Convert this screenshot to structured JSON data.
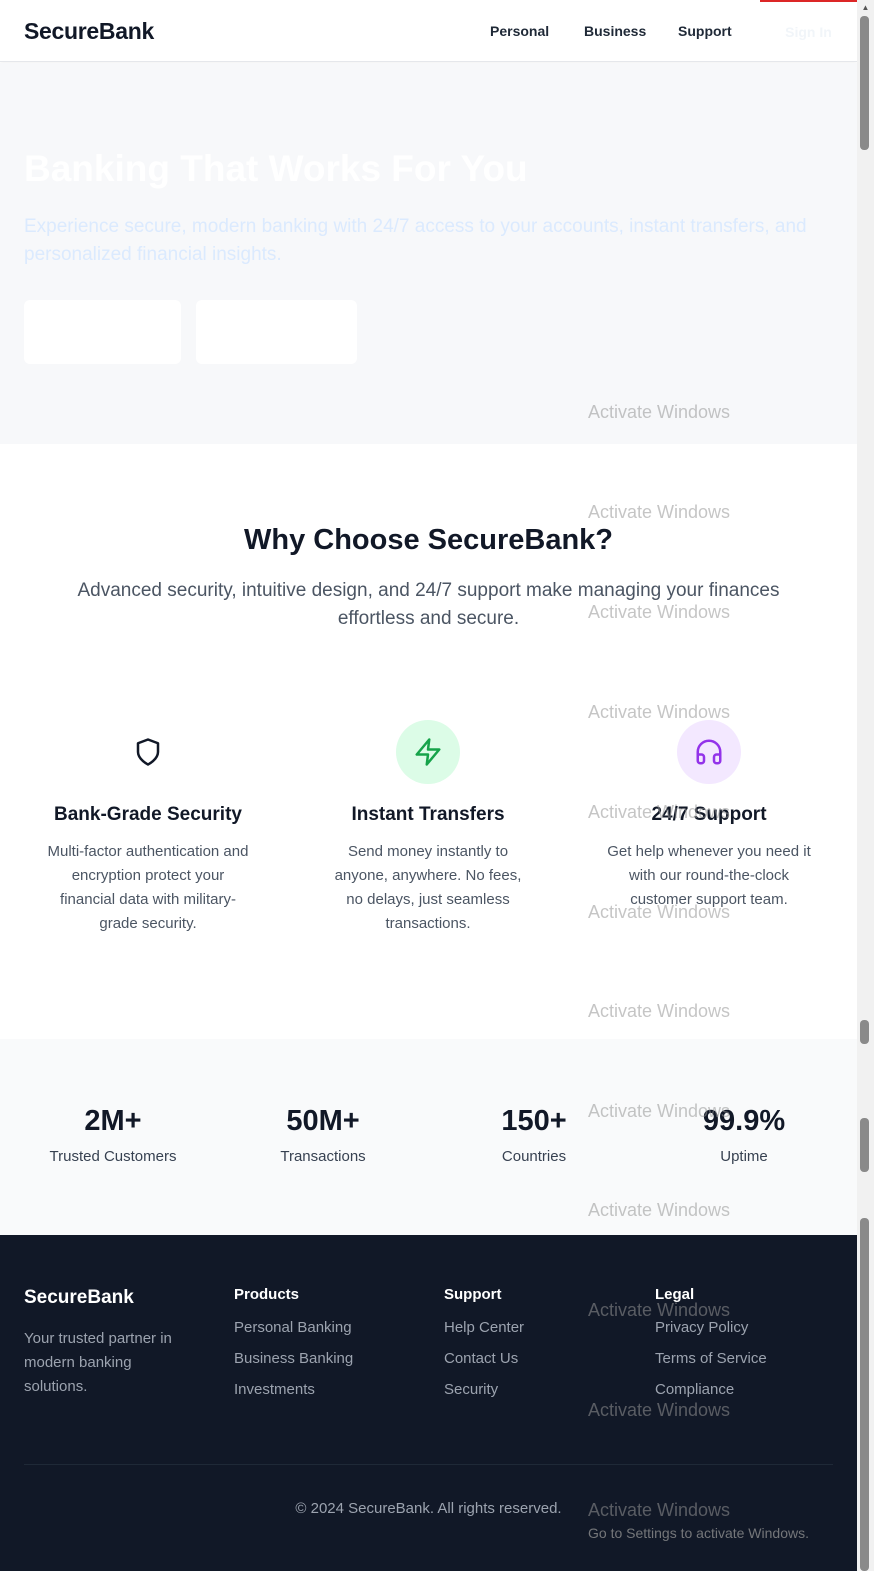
{
  "header": {
    "logo": "SecureBank",
    "nav": [
      "Personal",
      "Business",
      "Support"
    ],
    "signin": "Sign In"
  },
  "hero": {
    "title": "Banking That Works For You",
    "subtitle": "Experience secure, modern banking with 24/7 access to your accounts, instant transfers, and personalized financial insights."
  },
  "features": {
    "title": "Why Choose SecureBank?",
    "subtitle": "Advanced security, intuitive design, and 24/7 support make managing your finances effortless and secure.",
    "items": [
      {
        "icon": "shield-icon",
        "title": "Bank-Grade Security",
        "desc": "Multi-factor authentication and encryption protect your financial data with military-grade security."
      },
      {
        "icon": "lightning-icon",
        "title": "Instant Transfers",
        "desc": "Send money instantly to anyone, anywhere. No fees, no delays, just seamless transactions."
      },
      {
        "icon": "headphones-icon",
        "title": "24/7 Support",
        "desc": "Get help whenever you need it with our round-the-clock customer support team."
      }
    ]
  },
  "stats": [
    {
      "value": "2M+",
      "label": "Trusted Customers"
    },
    {
      "value": "50M+",
      "label": "Transactions"
    },
    {
      "value": "150+",
      "label": "Countries"
    },
    {
      "value": "99.9%",
      "label": "Uptime"
    }
  ],
  "footer": {
    "brand": "SecureBank",
    "tagline": "Your trusted partner in modern banking solutions.",
    "columns": [
      {
        "title": "Products",
        "links": [
          "Personal Banking",
          "Business Banking",
          "Investments"
        ]
      },
      {
        "title": "Support",
        "links": [
          "Help Center",
          "Contact Us",
          "Security"
        ]
      },
      {
        "title": "Legal",
        "links": [
          "Privacy Policy",
          "Terms of Service",
          "Compliance"
        ]
      }
    ],
    "copyright": "© 2024 SecureBank. All rights reserved."
  },
  "watermark": {
    "title": "Activate Windows",
    "subtitle": "Go to Settings to activate Windows."
  },
  "colors": {
    "primary_dark": "#111827",
    "green_icon": "#16a34a",
    "purple_icon": "#9333ea"
  }
}
